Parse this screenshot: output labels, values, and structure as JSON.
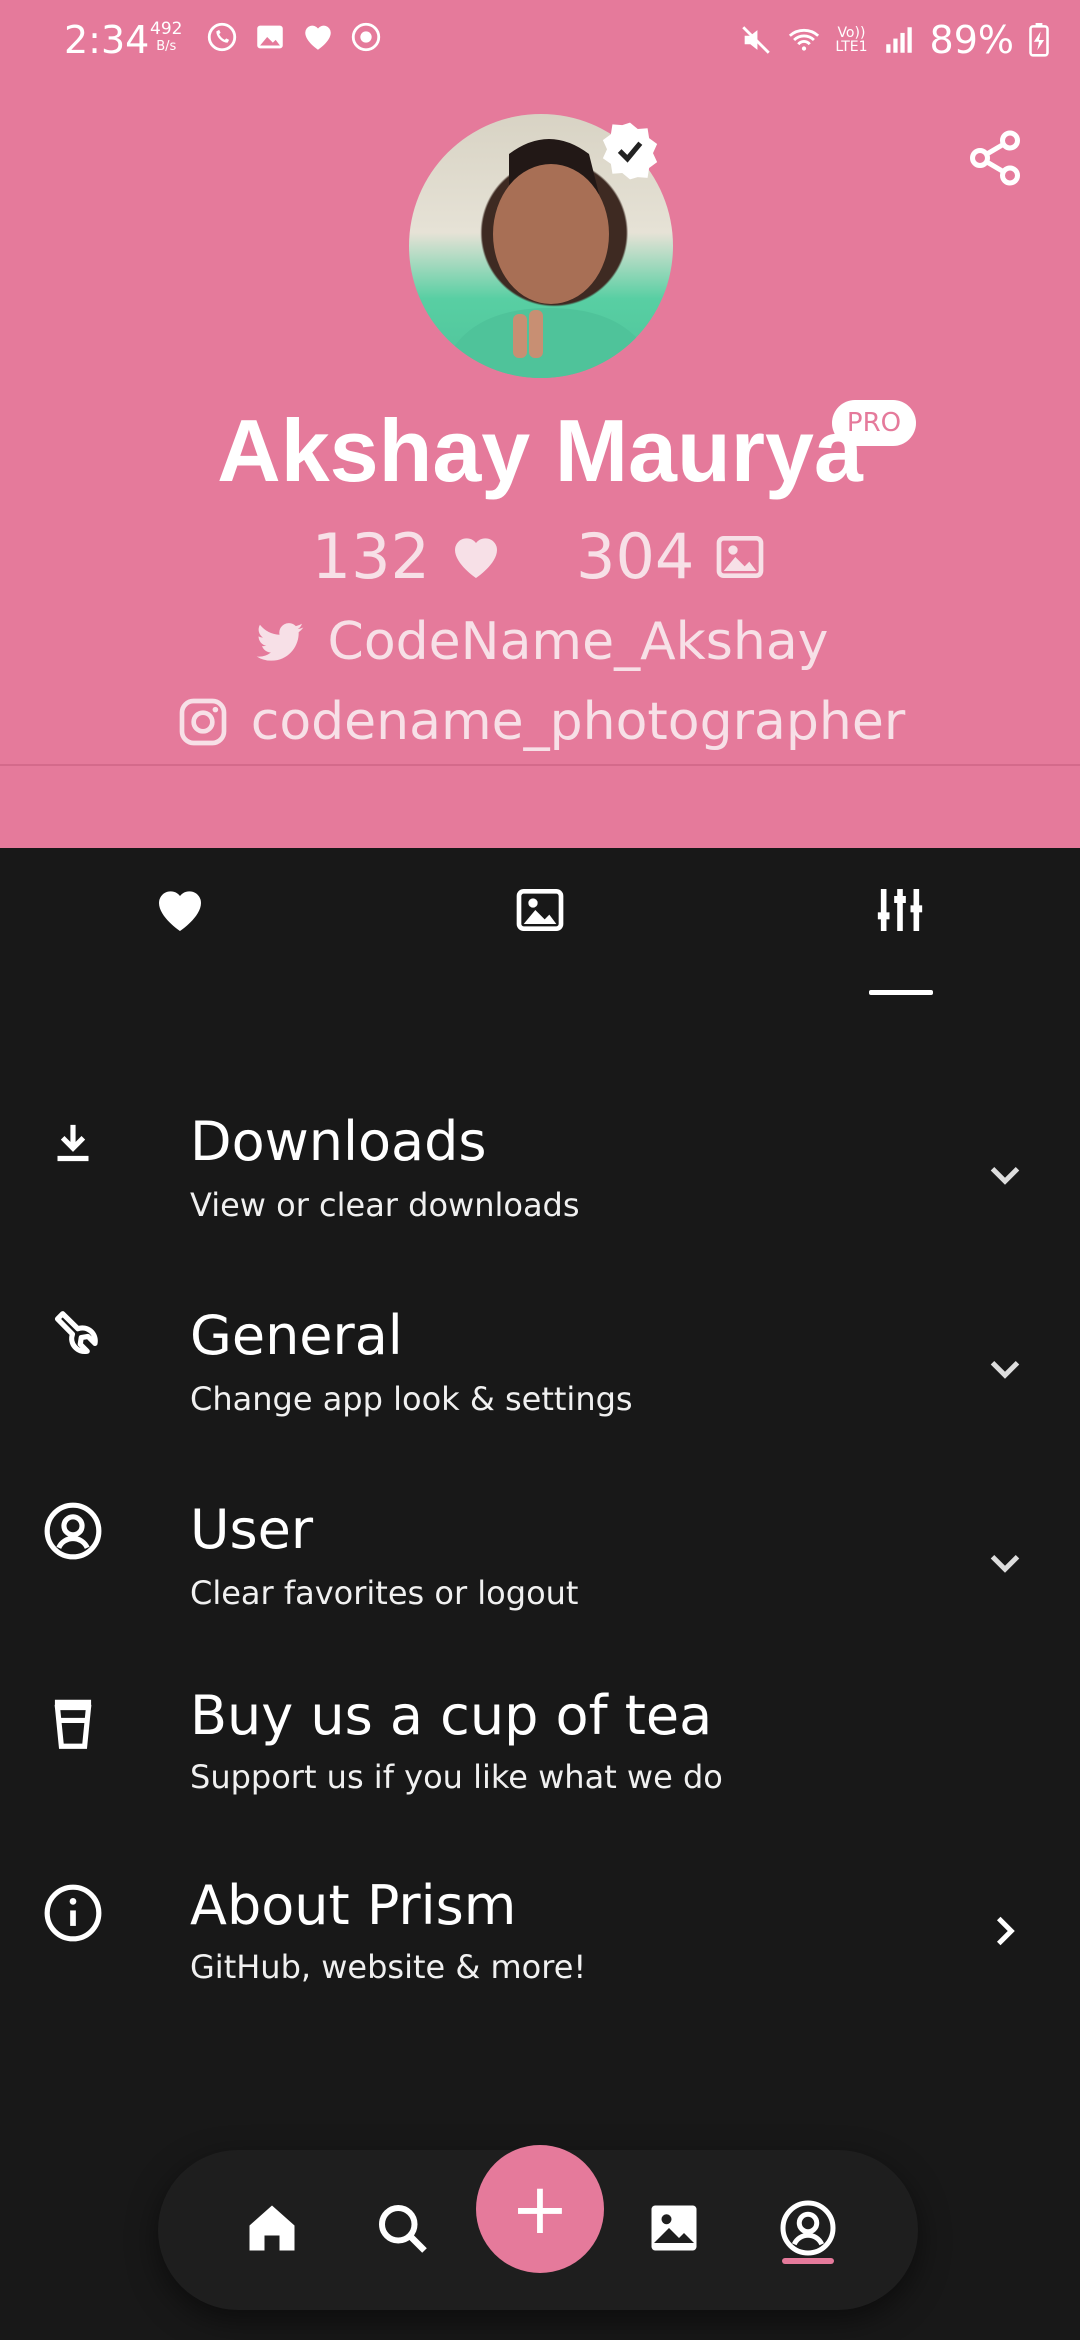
{
  "status_bar": {
    "time": "2:34",
    "net_speed_value": "492",
    "net_speed_unit": "B/s",
    "volte_label": "Vo))",
    "lte_label": "LTE1",
    "battery": "89%"
  },
  "profile": {
    "name": "Akshay Maurya",
    "badge": "PRO",
    "likes_count": "132",
    "wallpapers_count": "304",
    "twitter": "CodeName_Akshay",
    "instagram": "codename_photographer"
  },
  "tabs": [
    "favorites",
    "wallpapers",
    "settings"
  ],
  "menu": [
    {
      "title": "Downloads",
      "subtitle": "View or clear downloads",
      "icon": "download-icon",
      "chevron": "chevron-down-icon"
    },
    {
      "title": "General",
      "subtitle": "Change app look & settings",
      "icon": "wrench-icon",
      "chevron": "chevron-down-icon"
    },
    {
      "title": "User",
      "subtitle": "Clear favorites or logout",
      "icon": "user-circle-icon",
      "chevron": "chevron-down-icon"
    },
    {
      "title": "Buy us a cup of tea",
      "subtitle": "Support us if you like what we do",
      "icon": "cup-icon"
    },
    {
      "title": "About Prism",
      "subtitle": "GitHub, website & more!",
      "icon": "info-icon",
      "chevron": "chevron-right-icon"
    }
  ],
  "bottom_nav": {
    "add_label": "+"
  },
  "colors": {
    "accent": "#e57a9b",
    "background": "#181818"
  }
}
